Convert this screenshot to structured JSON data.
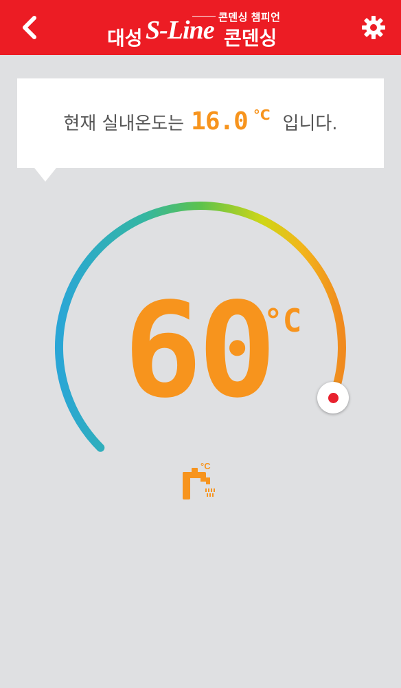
{
  "header": {
    "tagline": "콘덴싱 챔피언",
    "company": "대성",
    "brand": "S-Line",
    "product": "콘덴싱",
    "back_icon": "chevron-left-icon",
    "settings_icon": "gear-icon"
  },
  "room_status": {
    "prefix": "현재 실내온도는",
    "value": "16.0",
    "unit": "°C",
    "suffix": "입니다."
  },
  "water_gauge": {
    "target_temp": "60",
    "unit": "°C",
    "mode_icon": "hot-water-faucet-icon",
    "mode_unit": "°C",
    "level_fraction": 0.91
  },
  "colors": {
    "topbar": "#ec1c24",
    "accent": "#f7941d",
    "background": "#dfe0e2",
    "knob_dot": "#e8212e"
  }
}
